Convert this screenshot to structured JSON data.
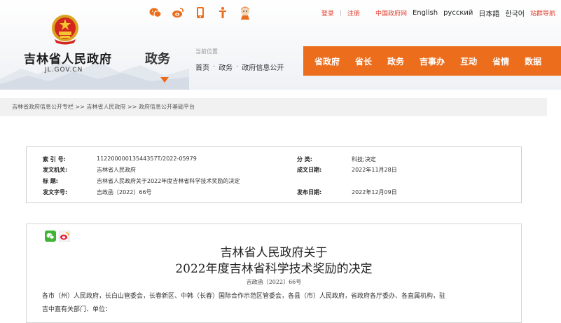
{
  "header": {
    "site_title": "吉林省人民政府",
    "site_domain": "JL.GOV.CN",
    "section_title": "政务",
    "location_label": "当前位置",
    "location": [
      "首页",
      "政务",
      "政府信息公开"
    ],
    "top_links": {
      "login": "登录",
      "register": "注册",
      "china_gov": "中国政府网",
      "english": "English",
      "russian": "русский",
      "japanese": "日本語",
      "korean": "한국어",
      "site_group": "站群导航"
    },
    "share_icons": [
      "wechat-icon",
      "weibo-icon",
      "mobile-icon",
      "accessibility-icon",
      "mascot-icon"
    ],
    "nav": [
      "省政府",
      "省长",
      "政务",
      "吉事办",
      "互动",
      "省情",
      "数据"
    ]
  },
  "breadcrumb": "吉林省政府信息公开专栏 >> 吉林省人民政府 >> 政府信息公开基础平台",
  "info": {
    "index_label": "索 引 号:",
    "index_value": "11220000013544357T/2022-05979",
    "category_label": "分    类:",
    "category_value": "科技;决定",
    "issuer_label": "发文机关:",
    "issuer_value": "吉林省人民政府",
    "created_label": "成文日期:",
    "created_value": "2022年11月28日",
    "title_label": "标    题:",
    "title_value": "吉林省人民政府关于2022年度吉林省科学技术奖励的决定",
    "docno_label": "发文字号:",
    "docno_value": "吉政函〔2022〕66号",
    "published_label": "发布日期:",
    "published_value": "2022年12月09日"
  },
  "doc": {
    "title_line1": "吉林省人民政府关于",
    "title_line2": "2022年度吉林省科学技术奖励的决定",
    "doc_number": "吉政函〔2022〕66号",
    "body_line1": "各市（州）人民政府，长白山管委会，长春新区、中韩（长春）国际合作示范区管委会，各县（市）人民政府，省政府各厅委办、各直属机构，驻",
    "body_line2": "吉中直有关部门、单位："
  },
  "colors": {
    "accent": "#ec6d1c",
    "link_red": "#e2402d"
  }
}
